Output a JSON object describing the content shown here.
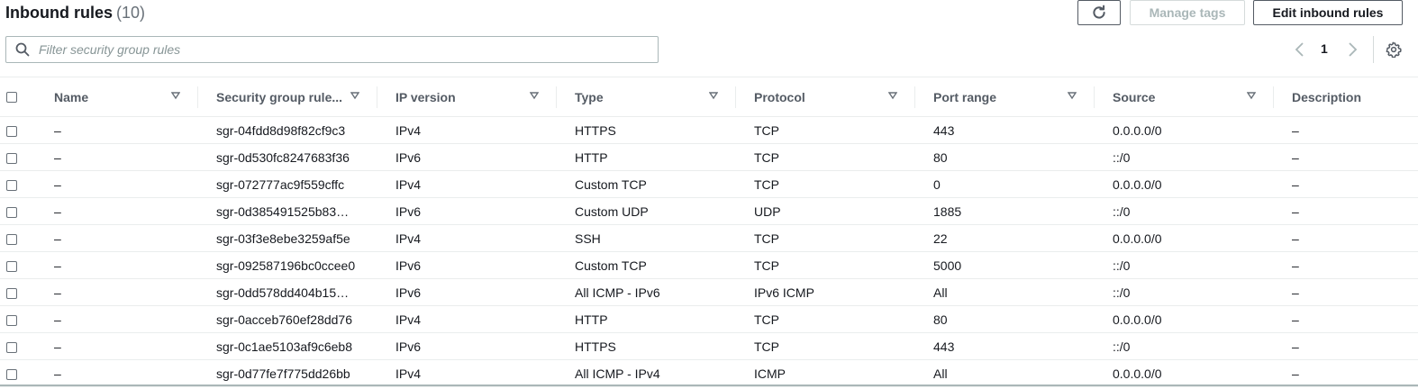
{
  "header": {
    "title": "Inbound rules",
    "count": "(10)"
  },
  "toolbar": {
    "refresh_icon": "refresh-icon",
    "manage_tags_label": "Manage tags",
    "edit_inbound_label": "Edit inbound rules"
  },
  "filter": {
    "placeholder": "Filter security group rules",
    "value": ""
  },
  "pagination": {
    "current_page": "1"
  },
  "table": {
    "columns": [
      {
        "label": "Name"
      },
      {
        "label": "Security group rule..."
      },
      {
        "label": "IP version"
      },
      {
        "label": "Type"
      },
      {
        "label": "Protocol"
      },
      {
        "label": "Port range"
      },
      {
        "label": "Source"
      },
      {
        "label": "Description"
      }
    ],
    "rows": [
      {
        "name": "–",
        "rule_id": "sgr-04fdd8d98f82cf9c3",
        "ip_version": "IPv4",
        "type": "HTTPS",
        "protocol": "TCP",
        "port_range": "443",
        "source": "0.0.0.0/0",
        "description": "–"
      },
      {
        "name": "–",
        "rule_id": "sgr-0d530fc8247683f36",
        "ip_version": "IPv6",
        "type": "HTTP",
        "protocol": "TCP",
        "port_range": "80",
        "source": "::/0",
        "description": "–"
      },
      {
        "name": "–",
        "rule_id": "sgr-072777ac9f559cffc",
        "ip_version": "IPv4",
        "type": "Custom TCP",
        "protocol": "TCP",
        "port_range": "0",
        "source": "0.0.0.0/0",
        "description": "–"
      },
      {
        "name": "–",
        "rule_id": "sgr-0d385491525b83…",
        "ip_version": "IPv6",
        "type": "Custom UDP",
        "protocol": "UDP",
        "port_range": "1885",
        "source": "::/0",
        "description": "–"
      },
      {
        "name": "–",
        "rule_id": "sgr-03f3e8ebe3259af5e",
        "ip_version": "IPv4",
        "type": "SSH",
        "protocol": "TCP",
        "port_range": "22",
        "source": "0.0.0.0/0",
        "description": "–"
      },
      {
        "name": "–",
        "rule_id": "sgr-092587196bc0ccee0",
        "ip_version": "IPv6",
        "type": "Custom TCP",
        "protocol": "TCP",
        "port_range": "5000",
        "source": "::/0",
        "description": "–"
      },
      {
        "name": "–",
        "rule_id": "sgr-0dd578dd404b15…",
        "ip_version": "IPv6",
        "type": "All ICMP - IPv6",
        "protocol": "IPv6 ICMP",
        "port_range": "All",
        "source": "::/0",
        "description": "–"
      },
      {
        "name": "–",
        "rule_id": "sgr-0acceb760ef28dd76",
        "ip_version": "IPv4",
        "type": "HTTP",
        "protocol": "TCP",
        "port_range": "80",
        "source": "0.0.0.0/0",
        "description": "–"
      },
      {
        "name": "–",
        "rule_id": "sgr-0c1ae5103af9c6eb8",
        "ip_version": "IPv6",
        "type": "HTTPS",
        "protocol": "TCP",
        "port_range": "443",
        "source": "::/0",
        "description": "–"
      },
      {
        "name": "–",
        "rule_id": "sgr-0d77fe7f775dd26bb",
        "ip_version": "IPv4",
        "type": "All ICMP - IPv4",
        "protocol": "ICMP",
        "port_range": "All",
        "source": "0.0.0.0/0",
        "description": "–"
      }
    ]
  }
}
